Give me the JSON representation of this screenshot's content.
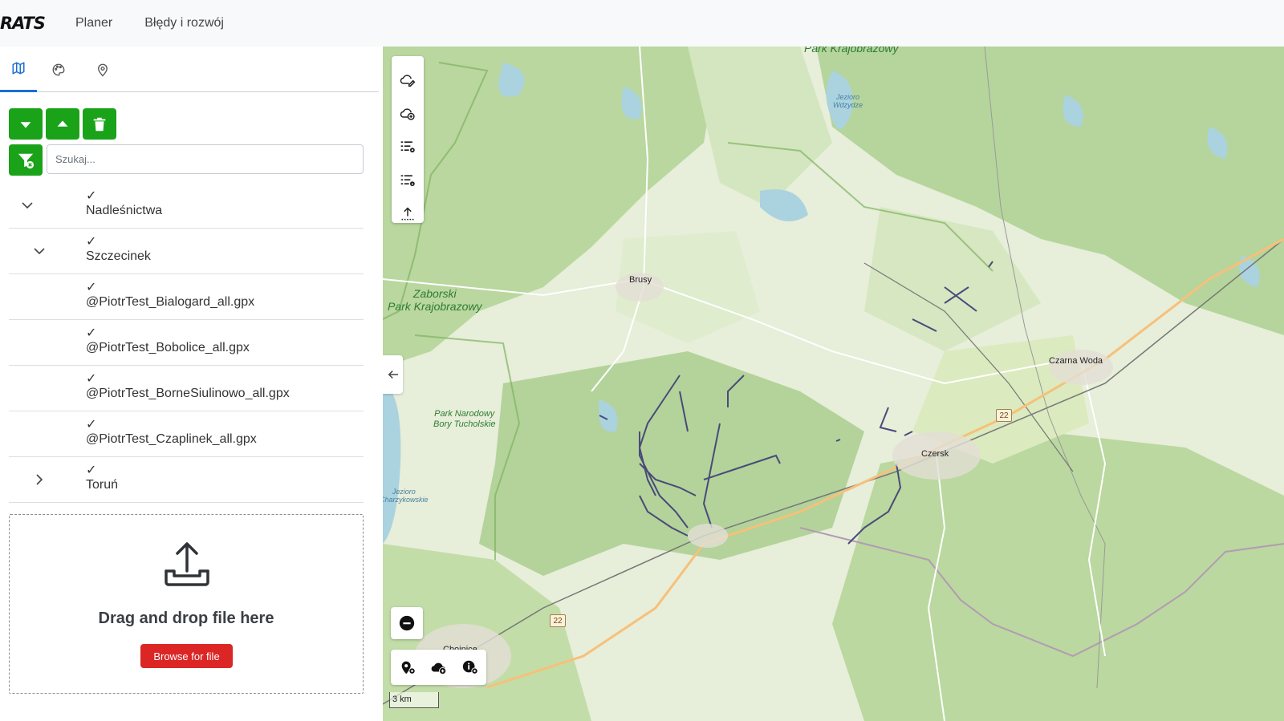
{
  "nav": {
    "brand": "RATS",
    "links": [
      "Planer",
      "Błędy i rozwój"
    ]
  },
  "sidebar": {
    "tabs": [
      {
        "icon": "map-icon",
        "active": true
      },
      {
        "icon": "palette-icon",
        "active": false
      },
      {
        "icon": "location-pin-icon",
        "active": false
      }
    ],
    "actions": {
      "expand_all": "chevron-down-icon",
      "collapse_all": "chevron-up-icon",
      "delete": "trash-icon",
      "filter_clear": "filter-clear-icon"
    },
    "search_placeholder": "Szukaj...",
    "tree": [
      {
        "check": "✓",
        "label": "Nadleśnictwa",
        "expander": "expanded"
      },
      {
        "check": "✓",
        "label": "Szczecinek",
        "expander": "expanded"
      },
      {
        "check": "✓",
        "label": "@PiotrTest_Bialogard_all.gpx",
        "expander": "none"
      },
      {
        "check": "✓",
        "label": "@PiotrTest_Bobolice_all.gpx",
        "expander": "none"
      },
      {
        "check": "✓",
        "label": "@PiotrTest_BorneSiulinowo_all.gpx",
        "expander": "none"
      },
      {
        "check": "✓",
        "label": "@PiotrTest_Czaplinek_all.gpx",
        "expander": "none"
      },
      {
        "check": "✓",
        "label": "Toruń",
        "expander": "collapsed"
      }
    ],
    "dropzone": {
      "text": "Drag and drop file here",
      "button": "Browse for file"
    }
  },
  "map": {
    "places": {
      "brusy": "Brusy",
      "czarna_woda": "Czarna Woda",
      "czersk": "Czersk",
      "chojnice": "Chojnice"
    },
    "parks": {
      "top": "Park Krajobrazowy",
      "zaborski": "Zaborski\nPark Krajobrazowy",
      "bory": "Park Narodowy\nBory Tucholskie"
    },
    "lakes": {
      "wdzydze": "Jezioro\nWdzydze",
      "charzykowskie": "Jezioro\nCharzykowskie"
    },
    "road_number": "22",
    "scale": "3 km",
    "colors": {
      "accent": "#1aa319",
      "danger": "#dc2626",
      "track": "#4a4a7a"
    }
  }
}
